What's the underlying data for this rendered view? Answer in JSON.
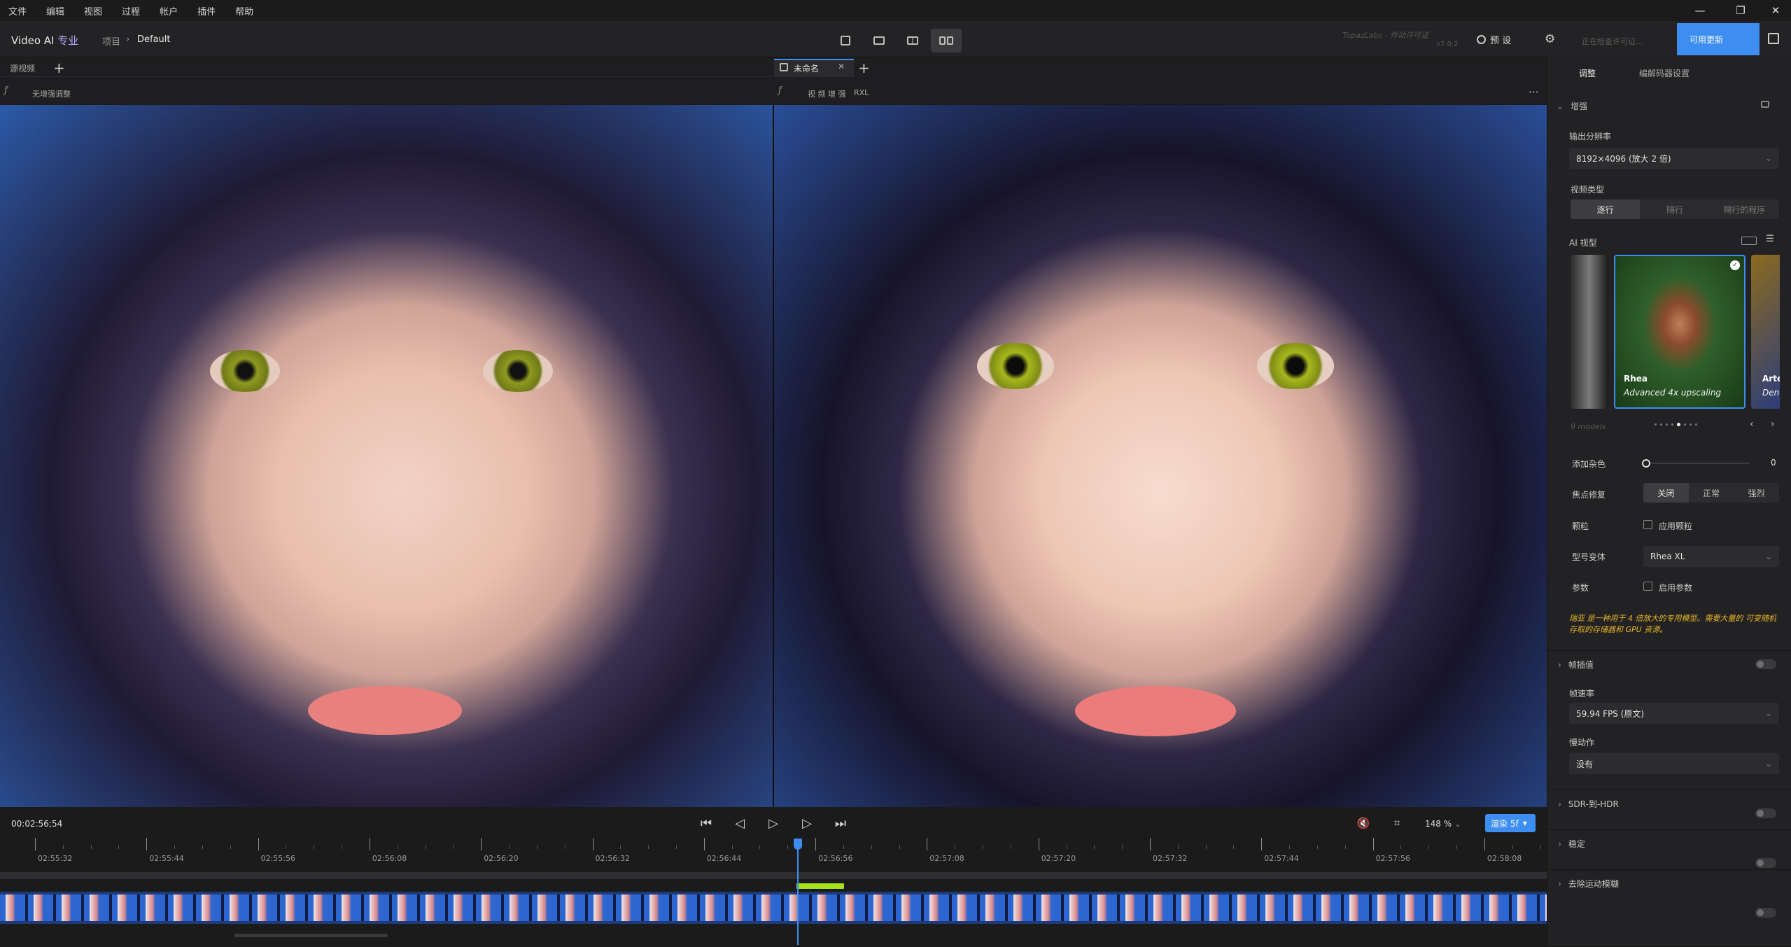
{
  "menu": [
    "文件",
    "编辑",
    "视图",
    "过程",
    "帐户",
    "插件",
    "帮助"
  ],
  "window_controls": {
    "minimize": "—",
    "restore": "❐",
    "close": "✕"
  },
  "header": {
    "app": "Video AI",
    "edition": "专业",
    "crumb_root": "项目",
    "crumb_sep": "›",
    "crumb_current": "Default"
  },
  "brand": {
    "watermark": "TopazLabs - 伴动许可证",
    "version": "v7.0.2"
  },
  "preview_button": "预 设",
  "license_placeholder": "正在检查许可证...",
  "update_button": "可用更新",
  "left_pane": {
    "tab": "源视频",
    "sub": "无增强调整"
  },
  "right_pane": {
    "tab": "未命名",
    "sub_a": "视 频 增 强",
    "sub_b": "RXL"
  },
  "timecode": "00:02:56;54",
  "zoom": "148 %",
  "render_button": "渲染 5f",
  "ticks": [
    "02:55:32",
    "02:55:44",
    "02:55:56",
    "02:56:08",
    "02:56:20",
    "02:56:32",
    "02:56:44",
    "02:56:56",
    "02:57:08",
    "02:57:20",
    "02:57:32",
    "02:57:44",
    "02:57:56",
    "02:58:08"
  ],
  "panel": {
    "tab_adjust": "调整",
    "tab_encoder": "编解码器设置",
    "section_enhance": "增强",
    "out_res_label": "输出分辨率",
    "out_res_value": "8192×4096 (放大 2 倍)",
    "video_type_label": "视频类型",
    "video_types": [
      "逐行",
      "隔行",
      "隔行的程序"
    ],
    "ai_model_label": "AI 视型",
    "model_name": "Rhea",
    "model_desc": "Advanced 4x upscaling",
    "model_next": "Arte",
    "model_next_desc": "Den",
    "models_count": "9 models",
    "add_noise_label": "添加杂色",
    "add_noise_value": "0",
    "focus_label": "焦点修复",
    "focus_opts": [
      "关闭",
      "正常",
      "强烈"
    ],
    "grain_label": "颗粒",
    "grain_check": "应用颗粒",
    "variant_label": "型号变体",
    "variant_value": "Rhea XL",
    "params_label": "参数",
    "params_check": "启用参数",
    "note": "瑞亚 是一种用于 4 倍放大的专用模型。需要大量的 可变随机存取的存储器和 GPU 资源。",
    "frame_interp": "帧插值",
    "fps_label": "帧速率",
    "fps_value": "59.94 FPS (原文)",
    "slowmo_label": "慢动作",
    "slowmo_value": "没有",
    "sdr_hdr": "SDR-到-HDR",
    "stabilize": "稳定",
    "motion_blur": "去除运动模糊"
  },
  "colors": {
    "accent": "#3d8ef0",
    "highlight": "#a6e01a",
    "note": "#e7b526",
    "panel": "#222224"
  }
}
